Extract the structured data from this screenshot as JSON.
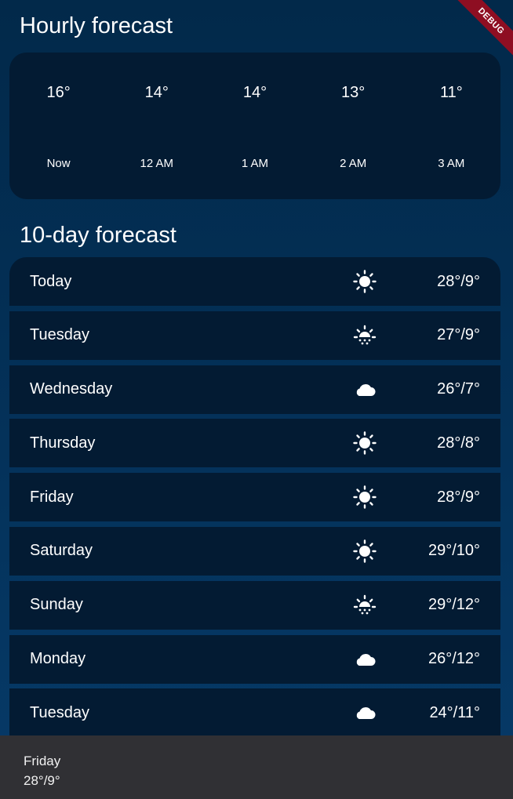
{
  "debug_banner": "DEBUG",
  "hourly": {
    "title": "Hourly forecast",
    "items": [
      {
        "temp": "16°",
        "icon": "moon-icon",
        "time": "Now"
      },
      {
        "temp": "14°",
        "icon": "moon-icon",
        "time": "12 AM"
      },
      {
        "temp": "14°",
        "icon": "moon-icon",
        "time": "1 AM"
      },
      {
        "temp": "13°",
        "icon": "moon-icon",
        "time": "2 AM"
      },
      {
        "temp": "11°",
        "icon": "moon-icon",
        "time": "3 AM"
      }
    ]
  },
  "daily": {
    "title": "10-day forecast",
    "items": [
      {
        "day": "Today",
        "icon": "sun-icon",
        "temp": "28°/9°"
      },
      {
        "day": "Tuesday",
        "icon": "partly-sunny-icon",
        "temp": "27°/9°"
      },
      {
        "day": "Wednesday",
        "icon": "cloud-icon",
        "temp": "26°/7°"
      },
      {
        "day": "Thursday",
        "icon": "sun-icon",
        "temp": "28°/8°"
      },
      {
        "day": "Friday",
        "icon": "sun-icon",
        "temp": "28°/9°"
      },
      {
        "day": "Saturday",
        "icon": "sun-icon",
        "temp": "29°/10°"
      },
      {
        "day": "Sunday",
        "icon": "partly-sunny-icon",
        "temp": "29°/12°"
      },
      {
        "day": "Monday",
        "icon": "cloud-icon",
        "temp": "26°/12°"
      },
      {
        "day": "Tuesday",
        "icon": "cloud-icon",
        "temp": "24°/11°"
      }
    ]
  },
  "snackbar": {
    "line1": "Friday",
    "line2": "28°/9°"
  },
  "colors": {
    "background_top": "#02294a",
    "card": "#031b33",
    "snackbar": "#303034",
    "debug_ribbon": "#8e0e22"
  }
}
